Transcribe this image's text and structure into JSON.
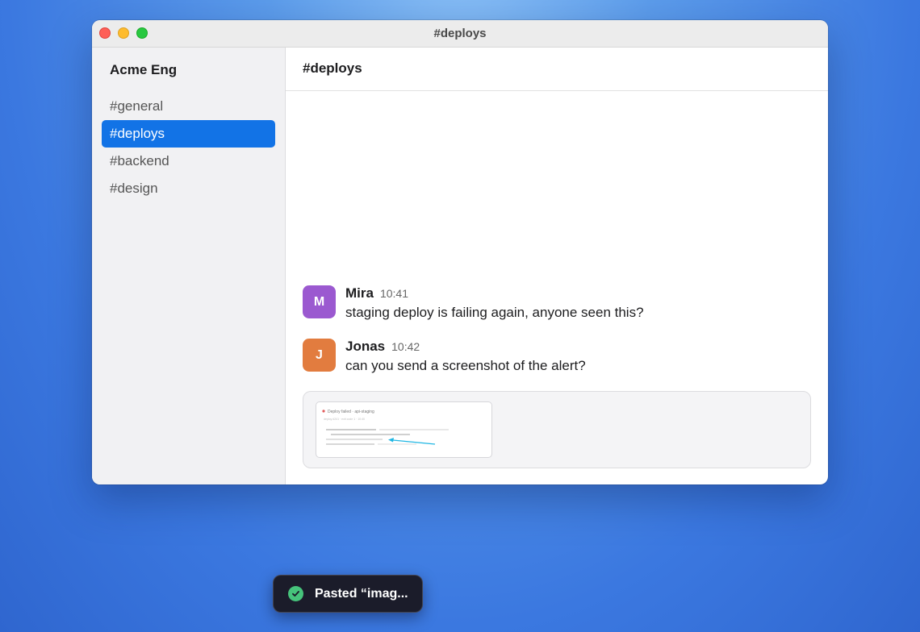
{
  "window": {
    "title": "#deploys"
  },
  "sidebar": {
    "workspace": "Acme Eng",
    "channels": [
      {
        "label": "#general",
        "active": false
      },
      {
        "label": "#deploys",
        "active": true
      },
      {
        "label": "#backend",
        "active": false
      },
      {
        "label": "#design",
        "active": false
      }
    ]
  },
  "channel": {
    "title": "#deploys"
  },
  "messages": [
    {
      "avatar": "M",
      "avatar_color": "#9b59d0",
      "author": "Mira",
      "time": "10:41",
      "text": "staging deploy is failing again, anyone seen this?"
    },
    {
      "avatar": "J",
      "avatar_color": "#e27c3f",
      "author": "Jonas",
      "time": "10:42",
      "text": "can you send a screenshot of the alert?"
    }
  ],
  "attachment": {
    "thumb_title": "Deploy failed · api-staging",
    "thumb_subtitle": "deploy #241 · exit code 1 · 10:40",
    "annotation_color": "#1fb6e3"
  },
  "toast": {
    "text": "Pasted “imag..."
  },
  "colors": {
    "accent": "#1273e6",
    "success": "#46c37b"
  }
}
